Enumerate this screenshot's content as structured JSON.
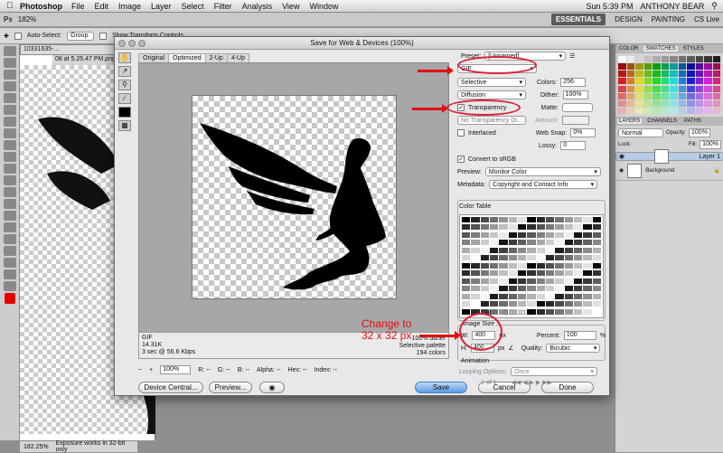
{
  "menubar": {
    "app": "Photoshop",
    "items": [
      "File",
      "Edit",
      "Image",
      "Layer",
      "Select",
      "Filter",
      "Analysis",
      "View",
      "Window"
    ],
    "clock": "Sun 5:39 PM",
    "user": "ANTHONY BEAR"
  },
  "appbar": {
    "zoom": "182%",
    "workspaces": [
      "ESSENTIALS",
      "DESIGN",
      "PAINTING"
    ],
    "cslive": "CS Live"
  },
  "optbar": {
    "auto_select": "Auto-Select:",
    "group": "Group",
    "show_transform": "Show Transform Controls"
  },
  "doc": {
    "tab": "10331635-...",
    "tab2": "08 at 5.25.47 PM.png",
    "status_zoom": "182.25%",
    "status_text": "Exposure works in 32-bit only"
  },
  "dialog": {
    "title": "Save for Web & Devices (100%)",
    "tabs": [
      "Original",
      "Optimized",
      "2-Up",
      "4-Up"
    ],
    "info": {
      "format": "GIF",
      "size": "14.31K",
      "time": "3 sec @ 56.6 Kbps",
      "dither": "100% dither",
      "palette": "Selective palette",
      "colors": "194 colors"
    },
    "zoom": "100%",
    "readout": [
      "R: --",
      "G: --",
      "B: --",
      "Alpha: --",
      "Hex: --",
      "Index: --"
    ],
    "buttons": {
      "device": "Device Central...",
      "preview": "Preview...",
      "save": "Save",
      "cancel": "Cancel",
      "done": "Done"
    },
    "settings": {
      "preset_label": "Preset:",
      "preset": "[Unnamed]",
      "format": "GIF",
      "reduction": "Selective",
      "colors_label": "Colors:",
      "colors": "256",
      "dither_algo": "Diffusion",
      "dither_label": "Dither:",
      "dither": "100%",
      "transparency": "Transparency",
      "matte_label": "Matte:",
      "trans_dither": "No Transparency Di...",
      "amount_label": "Amount:",
      "interlaced": "Interlaced",
      "websnap_label": "Web Snap:",
      "websnap": "0%",
      "lossy_label": "Lossy:",
      "lossy": "0",
      "convert": "Convert to sRGB",
      "preview_label": "Preview:",
      "preview": "Monitor Color",
      "metadata_label": "Metadata:",
      "metadata": "Copyright and Contact Info",
      "color_table": "Color Table",
      "color_count": "194",
      "image_size": "Image Size",
      "w_label": "W:",
      "w": "400",
      "h_label": "H:",
      "h": "400",
      "px": "px",
      "percent_label": "Percent:",
      "percent": "100",
      "pct": "%",
      "quality_label": "Quality:",
      "quality": "Bicubic",
      "animation": "Animation",
      "looping_label": "Looping Options:",
      "looping": "Once",
      "frames": "1 of 1"
    }
  },
  "annotation": {
    "line1": "Change to",
    "line2": "32 x 32 px",
    "color": "#e01010"
  },
  "panels": {
    "tabs1": [
      "COLOR",
      "SWATCHES",
      "STYLES"
    ],
    "tabs2": [
      "LAYERS",
      "CHANNELS",
      "PATHS"
    ],
    "mode": "Normal",
    "opacity_label": "Opacity:",
    "opacity": "100%",
    "lock_label": "Lock:",
    "fill_label": "Fill:",
    "fill": "100%",
    "layers": [
      "Layer 1",
      "Background"
    ]
  }
}
